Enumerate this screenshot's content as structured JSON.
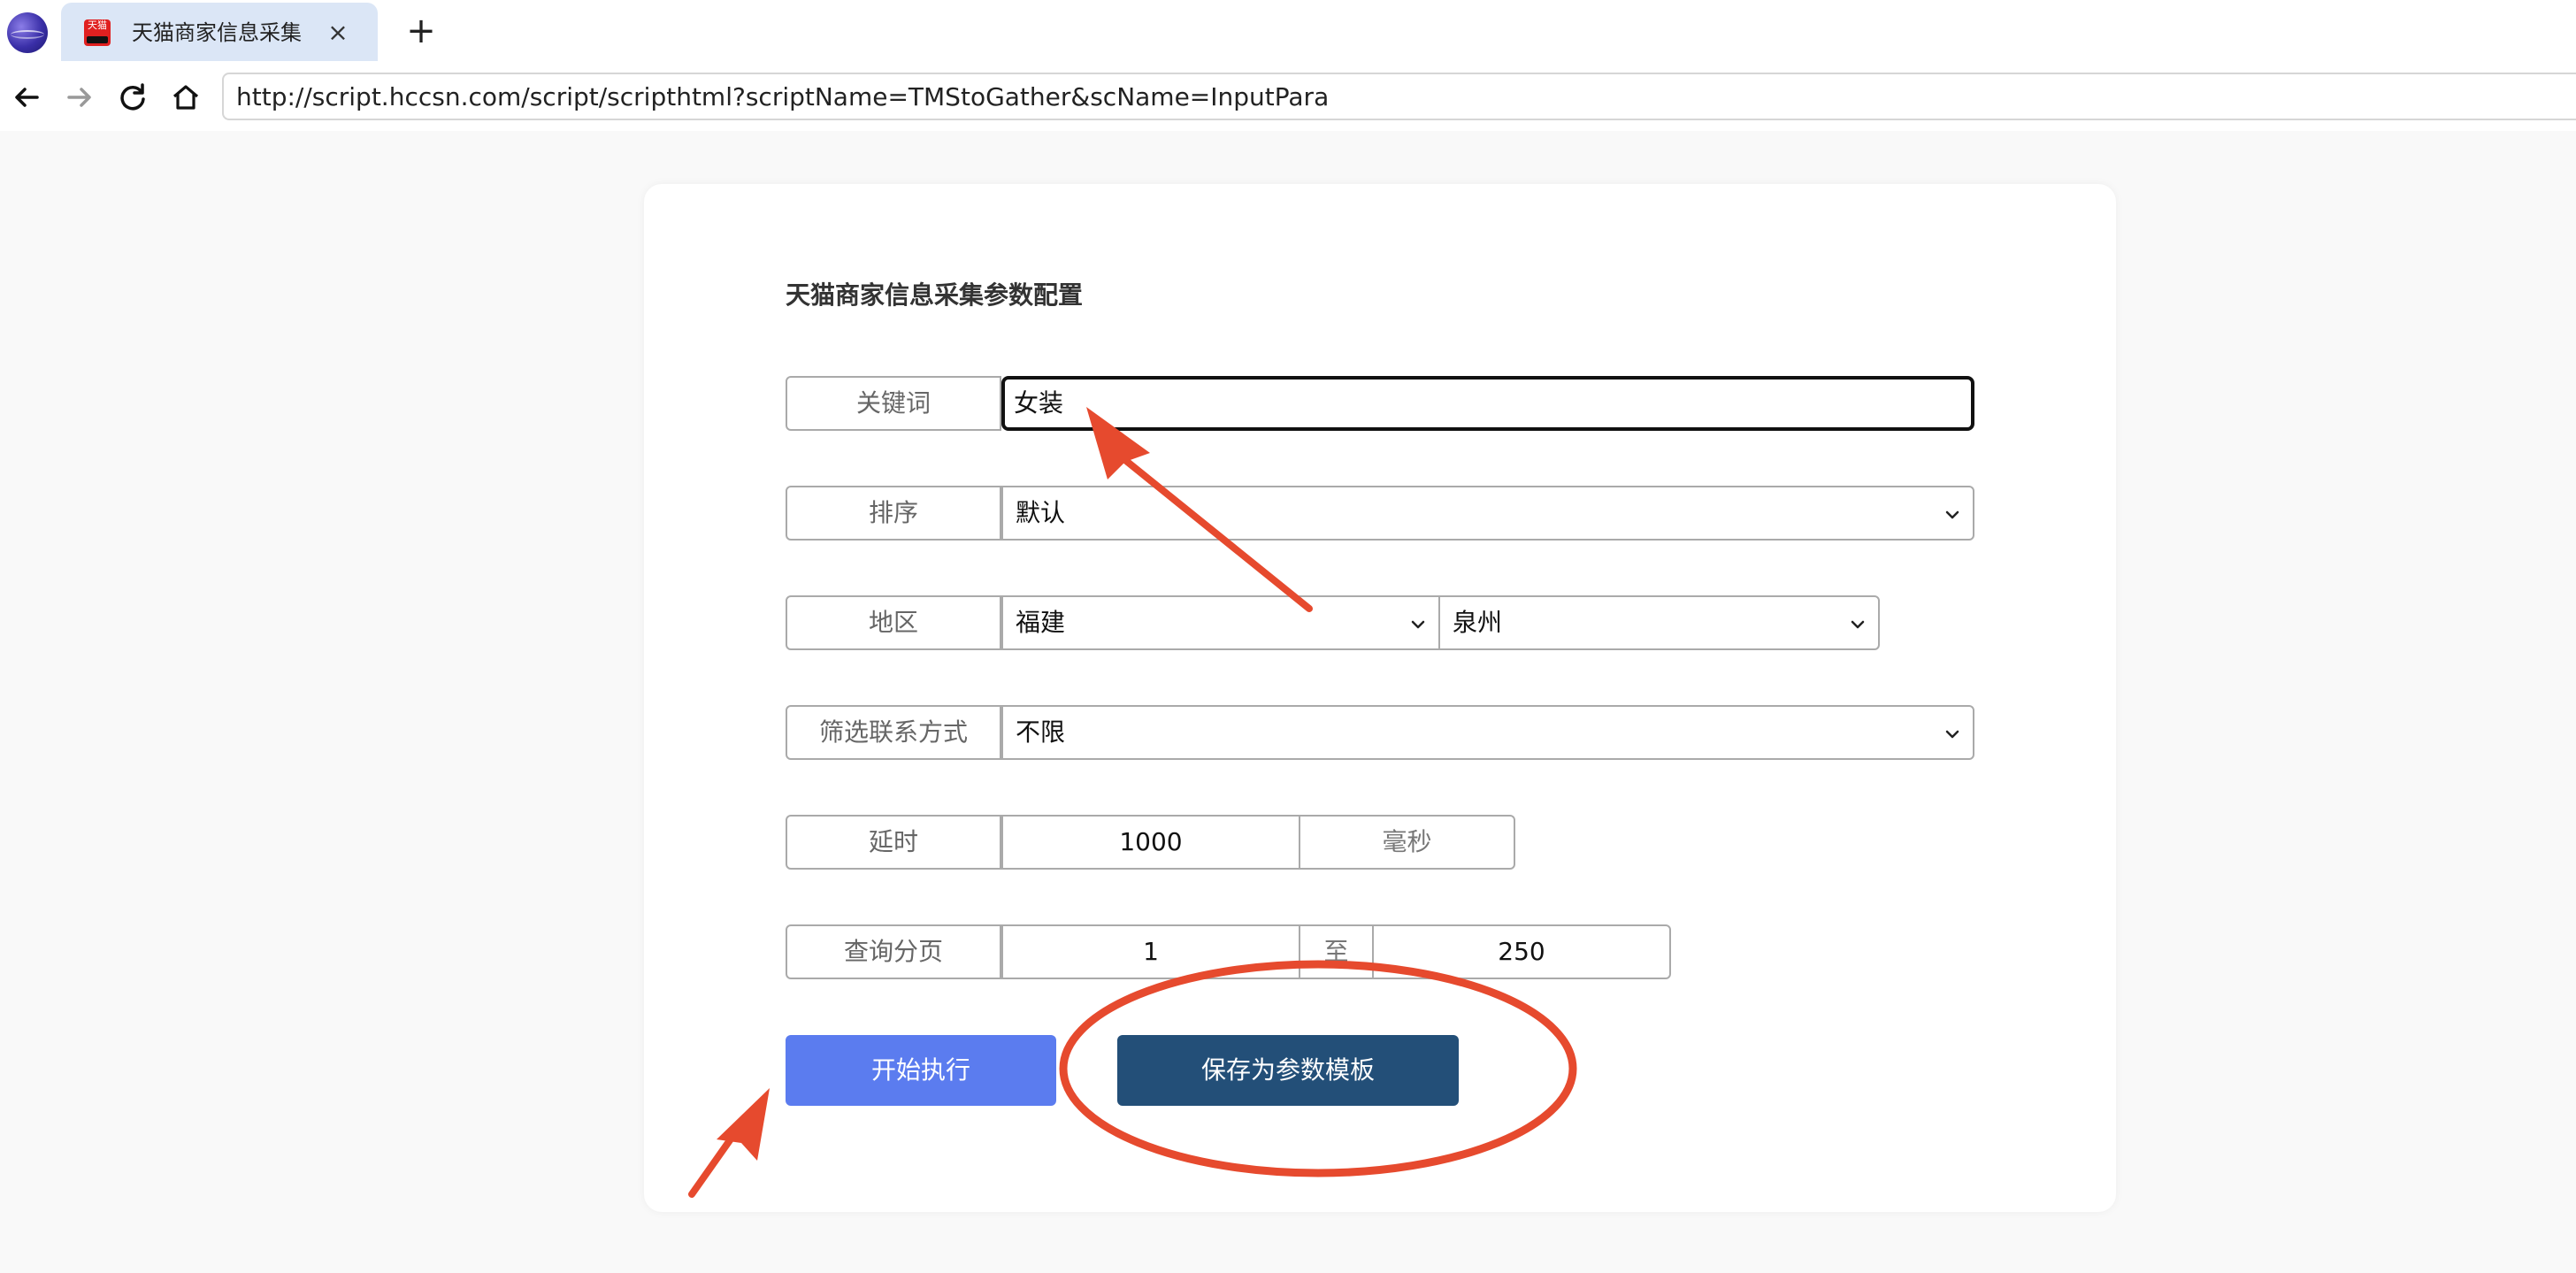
{
  "browser": {
    "tab_title": "天猫商家信息采集",
    "tab_favicon_text": "天猫",
    "url": "http://script.hccsn.com/script/scripthtml?scriptName=TMStoGather&scName=InputPara"
  },
  "form": {
    "title": "天猫商家信息采集参数配置",
    "keyword": {
      "label": "关键词",
      "value": "女装"
    },
    "sort": {
      "label": "排序",
      "value": "默认"
    },
    "region": {
      "label": "地区",
      "province": "福建",
      "city": "泉州"
    },
    "contact_filter": {
      "label": "筛选联系方式",
      "value": "不限"
    },
    "delay": {
      "label": "延时",
      "value": "1000",
      "unit": "毫秒"
    },
    "page_query": {
      "label": "查询分页",
      "from": "1",
      "separator": "至",
      "to": "250"
    },
    "start_button": "开始执行",
    "save_button": "保存为参数模板"
  },
  "annotations": {
    "color": "#e64a2e"
  }
}
